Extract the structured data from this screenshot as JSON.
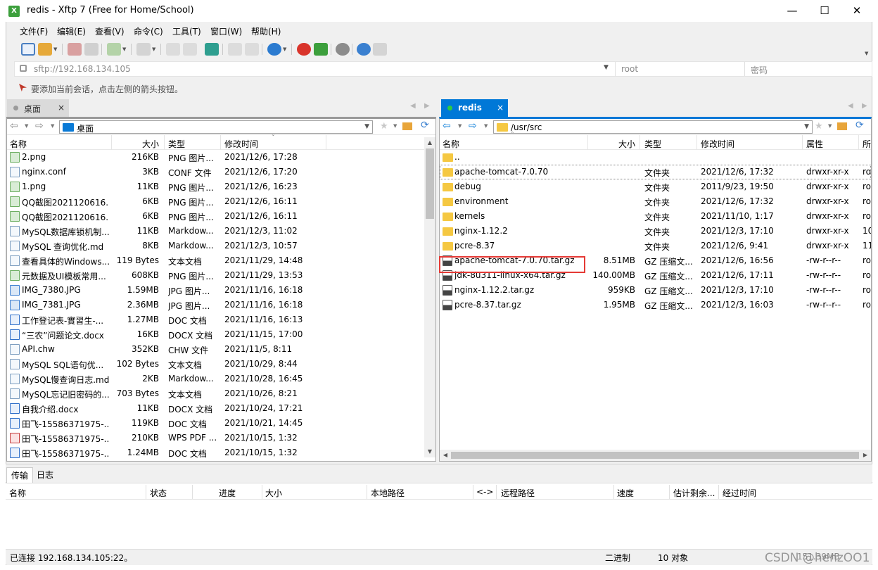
{
  "window": {
    "title": "redis - Xftp 7 (Free for Home/School)",
    "minimize": "—",
    "maximize": "☐",
    "close": "✕"
  },
  "menu": [
    "文件(F)",
    "编辑(E)",
    "查看(V)",
    "命令(C)",
    "工具(T)",
    "窗口(W)",
    "帮助(H)"
  ],
  "address": {
    "url": "sftp://192.168.134.105",
    "user_placeholder": "root",
    "password_placeholder": "密码"
  },
  "hint": "要添加当前会话，点击左侧的箭头按钮。",
  "left_tab": {
    "label": "桌面",
    "close": "×"
  },
  "right_tab": {
    "label": "redis",
    "close": "×"
  },
  "left": {
    "path": "桌面",
    "columns": [
      "名称",
      "大小",
      "类型",
      "修改时间"
    ],
    "files": [
      {
        "name": "2.png",
        "size": "216KB",
        "type": "PNG 图片...",
        "mtime": "2021/12/6, 17:28",
        "icon": "png"
      },
      {
        "name": "nginx.conf",
        "size": "3KB",
        "type": "CONF 文件",
        "mtime": "2021/12/6, 17:20",
        "icon": "file"
      },
      {
        "name": "1.png",
        "size": "11KB",
        "type": "PNG 图片...",
        "mtime": "2021/12/6, 16:23",
        "icon": "png"
      },
      {
        "name": "QQ截图2021120616...",
        "size": "6KB",
        "type": "PNG 图片...",
        "mtime": "2021/12/6, 16:11",
        "icon": "png"
      },
      {
        "name": "QQ截图2021120616...",
        "size": "6KB",
        "type": "PNG 图片...",
        "mtime": "2021/12/6, 16:11",
        "icon": "png"
      },
      {
        "name": "MySQL数据库锁机制...",
        "size": "11KB",
        "type": "Markdow...",
        "mtime": "2021/12/3, 11:02",
        "icon": "file"
      },
      {
        "name": "MySQL 查询优化.md",
        "size": "8KB",
        "type": "Markdow...",
        "mtime": "2021/12/3, 10:57",
        "icon": "file"
      },
      {
        "name": "查看具体的Windows...",
        "size": "119 Bytes",
        "type": "文本文档",
        "mtime": "2021/11/29, 14:48",
        "icon": "file"
      },
      {
        "name": "元数据及UI模板常用...",
        "size": "608KB",
        "type": "PNG 图片...",
        "mtime": "2021/11/29, 13:53",
        "icon": "png"
      },
      {
        "name": "IMG_7380.JPG",
        "size": "1.59MB",
        "type": "JPG 图片...",
        "mtime": "2021/11/16, 16:18",
        "icon": "jpg"
      },
      {
        "name": "IMG_7381.JPG",
        "size": "2.36MB",
        "type": "JPG 图片...",
        "mtime": "2021/11/16, 16:18",
        "icon": "jpg"
      },
      {
        "name": "工作登记表-實習生-...",
        "size": "1.27MB",
        "type": "DOC 文档",
        "mtime": "2021/11/16, 16:13",
        "icon": "doc"
      },
      {
        "name": "“三农”问题论文.docx",
        "size": "16KB",
        "type": "DOCX 文档",
        "mtime": "2021/11/15, 17:00",
        "icon": "doc"
      },
      {
        "name": "API.chw",
        "size": "352KB",
        "type": "CHW 文件",
        "mtime": "2021/11/5, 8:11",
        "icon": "file"
      },
      {
        "name": "MySQL SQL语句优...",
        "size": "102 Bytes",
        "type": "文本文档",
        "mtime": "2021/10/29, 8:44",
        "icon": "file"
      },
      {
        "name": "MySQL慢查询日志.md",
        "size": "2KB",
        "type": "Markdow...",
        "mtime": "2021/10/28, 16:45",
        "icon": "file"
      },
      {
        "name": "MySQL忘记旧密码的...",
        "size": "703 Bytes",
        "type": "文本文档",
        "mtime": "2021/10/26, 8:21",
        "icon": "file"
      },
      {
        "name": "自我介绍.docx",
        "size": "11KB",
        "type": "DOCX 文档",
        "mtime": "2021/10/24, 17:21",
        "icon": "doc"
      },
      {
        "name": "田飞-15586371975-...",
        "size": "119KB",
        "type": "DOC 文档",
        "mtime": "2021/10/21, 14:45",
        "icon": "doc"
      },
      {
        "name": "田飞-15586371975-...",
        "size": "210KB",
        "type": "WPS PDF ...",
        "mtime": "2021/10/15, 1:32",
        "icon": "wps"
      },
      {
        "name": "田飞-15586371975-...",
        "size": "1.24MB",
        "type": "DOC 文档",
        "mtime": "2021/10/15, 1:32",
        "icon": "doc"
      }
    ]
  },
  "right": {
    "path": "/usr/src",
    "columns": [
      "名称",
      "大小",
      "类型",
      "修改时间",
      "属性",
      "所"
    ],
    "files": [
      {
        "name": "..",
        "size": "",
        "type": "",
        "mtime": "",
        "attr": "",
        "owner": "",
        "icon": "up"
      },
      {
        "name": "apache-tomcat-7.0.70",
        "size": "",
        "type": "文件夹",
        "mtime": "2021/12/6, 17:32",
        "attr": "drwxr-xr-x",
        "owner": "ro",
        "icon": "folder"
      },
      {
        "name": "debug",
        "size": "",
        "type": "文件夹",
        "mtime": "2011/9/23, 19:50",
        "attr": "drwxr-xr-x",
        "owner": "ro",
        "icon": "folder"
      },
      {
        "name": "environment",
        "size": "",
        "type": "文件夹",
        "mtime": "2021/12/6, 17:32",
        "attr": "drwxr-xr-x",
        "owner": "ro",
        "icon": "folder"
      },
      {
        "name": "kernels",
        "size": "",
        "type": "文件夹",
        "mtime": "2021/11/10, 1:17",
        "attr": "drwxr-xr-x",
        "owner": "ro",
        "icon": "folder"
      },
      {
        "name": "nginx-1.12.2",
        "size": "",
        "type": "文件夹",
        "mtime": "2021/12/3, 17:10",
        "attr": "drwxr-xr-x",
        "owner": "10",
        "icon": "folder"
      },
      {
        "name": "pcre-8.37",
        "size": "",
        "type": "文件夹",
        "mtime": "2021/12/6, 9:41",
        "attr": "drwxr-xr-x",
        "owner": "11",
        "icon": "folder"
      },
      {
        "name": "apache-tomcat-7.0.70.tar.gz",
        "size": "8.51MB",
        "type": "GZ 压缩文...",
        "mtime": "2021/12/6, 16:56",
        "attr": "-rw-r--r--",
        "owner": "ro",
        "icon": "gz"
      },
      {
        "name": "jdk-8u311-linux-x64.tar.gz",
        "size": "140.00MB",
        "type": "GZ 压缩文...",
        "mtime": "2021/12/6, 17:11",
        "attr": "-rw-r--r--",
        "owner": "ro",
        "icon": "gz"
      },
      {
        "name": "nginx-1.12.2.tar.gz",
        "size": "959KB",
        "type": "GZ 压缩文...",
        "mtime": "2021/12/3, 17:10",
        "attr": "-rw-r--r--",
        "owner": "ro",
        "icon": "gz"
      },
      {
        "name": "pcre-8.37.tar.gz",
        "size": "1.95MB",
        "type": "GZ 压缩文...",
        "mtime": "2021/12/3, 16:03",
        "attr": "-rw-r--r--",
        "owner": "ro",
        "icon": "gz"
      }
    ]
  },
  "bottom_tabs": [
    "传输",
    "日志"
  ],
  "transfer_columns": [
    "名称",
    "状态",
    "进度",
    "大小",
    "本地路径",
    "<->",
    "远程路径",
    "速度",
    "估计剩余...",
    "经过时间"
  ],
  "status": {
    "connection": "已连接 192.168.134.105:22。",
    "mode": "二进制",
    "objects": "10 对象",
    "size": "151.39MB"
  },
  "watermark": "CSDN @henzOO1",
  "colors": {
    "accent": "#0078d7",
    "highlight": "#e53935",
    "folder": "#f5c842"
  }
}
